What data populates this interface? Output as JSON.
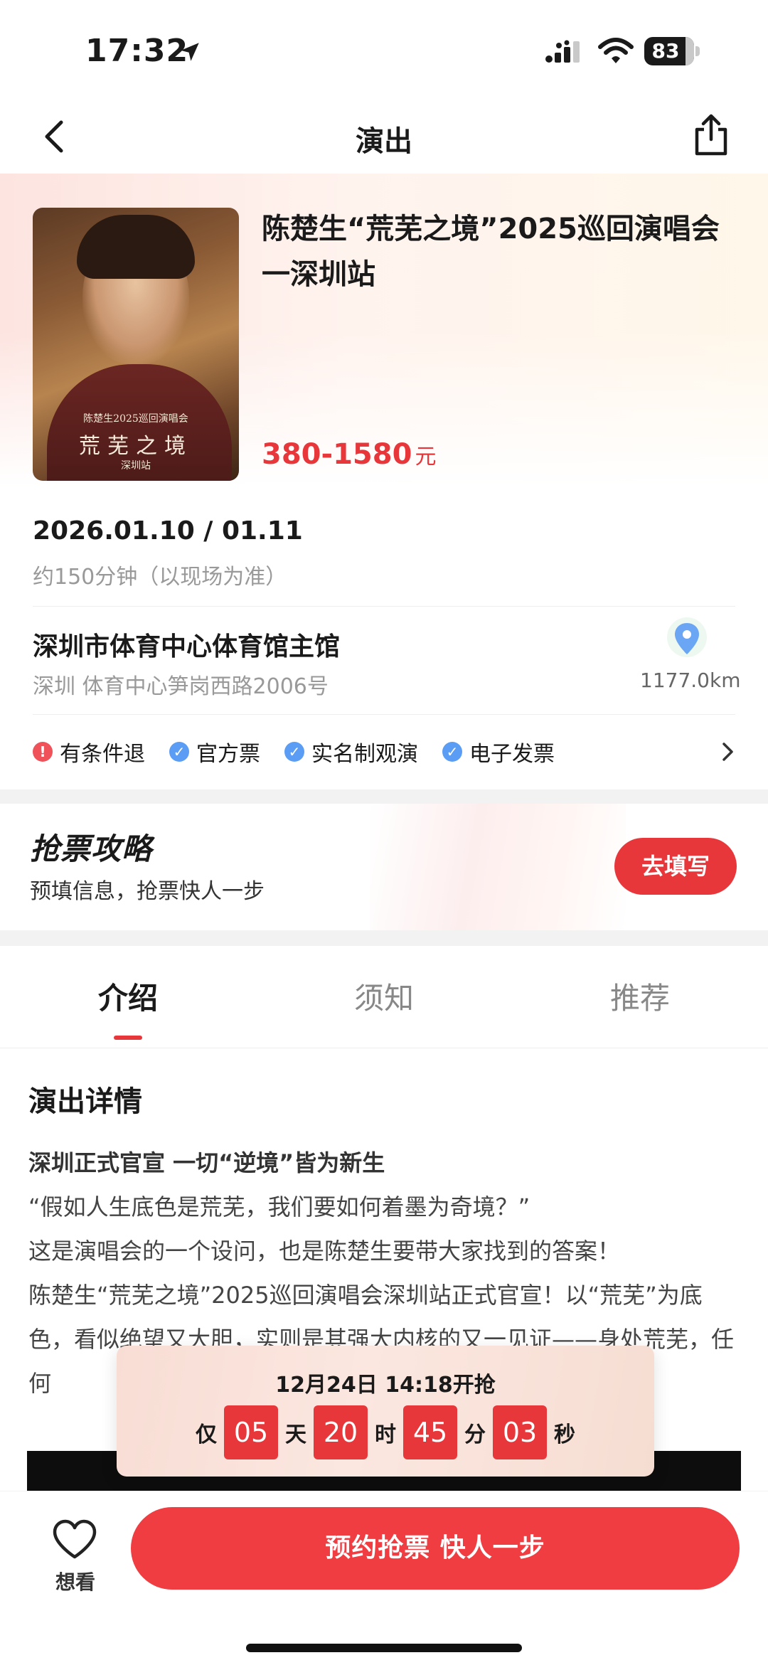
{
  "status_bar": {
    "time": "17:32",
    "battery": "83"
  },
  "nav": {
    "title": "演出"
  },
  "event": {
    "title": "陈楚生“荒芜之境”2025巡回演唱会一深圳站",
    "price": "380-1580",
    "price_unit": "元",
    "poster": {
      "small_text": "陈楚生2025巡回演唱会",
      "title": "荒芜之境",
      "city": "深圳站"
    }
  },
  "schedule": {
    "date": "2026.01.10 / 01.11",
    "duration": "约150分钟（以现场为准）"
  },
  "venue": {
    "name": "深圳市体育中心体育馆主馆",
    "address": "深圳 体育中心笋岗西路2006号",
    "distance": "1177.0km"
  },
  "tags": [
    {
      "label": "有条件退",
      "icon": "exclamation-icon"
    },
    {
      "label": "官方票",
      "icon": "check-icon"
    },
    {
      "label": "实名制观演",
      "icon": "check-icon"
    },
    {
      "label": "电子发票",
      "icon": "check-icon"
    }
  ],
  "strategy": {
    "title": "抢票攻略",
    "subtitle": "预填信息，抢票快人一步",
    "button": "去填写"
  },
  "tabs": [
    {
      "label": "介绍"
    },
    {
      "label": "须知"
    },
    {
      "label": "推荐"
    }
  ],
  "details": {
    "heading": "演出详情",
    "lines": [
      "深圳正式官宣 一切“逆境”皆为新生",
      "“假如人生底色是荒芜，我们要如何着墨为奇境？”",
      "这是演唱会的一个设问，也是陈楚生要带大家找到的答案！",
      "陈楚生“荒芜之境”2025巡回演唱会深圳站正式官宣！以“荒芜”为底色，看似绝望又大胆，实则是其强大内核的又一见证——身处荒芜，任何"
    ]
  },
  "countdown": {
    "title": "12月24日  14:18开抢",
    "prefix": "仅",
    "days": "05",
    "days_label": "天",
    "hours": "20",
    "hours_label": "时",
    "minutes": "45",
    "minutes_label": "分",
    "seconds": "03",
    "seconds_label": "秒"
  },
  "bottom": {
    "want_label": "想看",
    "reserve_button": "预约抢票  快人一步"
  },
  "colors": {
    "accent": "#e8373b",
    "check": "#5b9df5",
    "warn": "#f0525a"
  }
}
